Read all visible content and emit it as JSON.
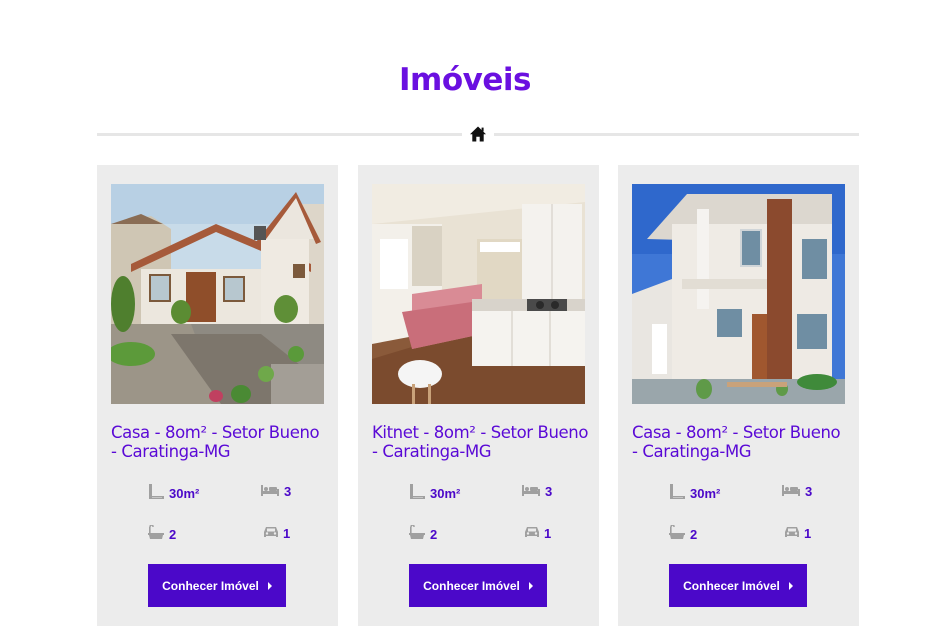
{
  "section": {
    "title": "Imóveis"
  },
  "colors": {
    "title": "#6a0fe0",
    "accent": "#4b08c9",
    "card_bg": "#ececec",
    "divider": "#e6e6e6"
  },
  "cards": [
    {
      "title": "Casa - 8om² - Setor Bueno - Caratinga-MG",
      "area": "30m²",
      "bedrooms": "3",
      "bathrooms": "2",
      "parking": "1",
      "button_label": "Conhecer Imóvel"
    },
    {
      "title": "Kitnet - 8om² - Setor Bueno - Caratinga-MG",
      "area": "30m²",
      "bedrooms": "3",
      "bathrooms": "2",
      "parking": "1",
      "button_label": "Conhecer Imóvel"
    },
    {
      "title": "Casa - 8om² - Setor Bueno - Caratinga-MG",
      "area": "30m²",
      "bedrooms": "3",
      "bathrooms": "2",
      "parking": "1",
      "button_label": "Conhecer Imóvel"
    }
  ],
  "icons": {
    "divider": "home-icon",
    "area": "area-ruler-icon",
    "bedrooms": "bed-icon",
    "bathrooms": "bathtub-icon",
    "parking": "car-icon",
    "button": "caret-right-icon"
  }
}
